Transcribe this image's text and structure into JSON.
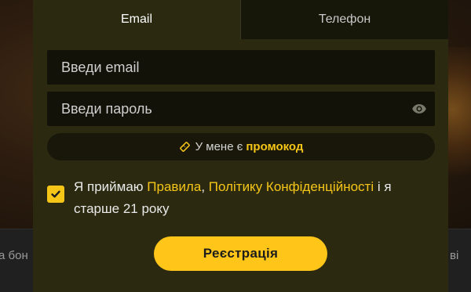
{
  "background": {
    "left_text": "а бон",
    "right_text": "ві"
  },
  "tabs": [
    {
      "label": "Email",
      "active": true
    },
    {
      "label": "Телефон",
      "active": false
    }
  ],
  "email": {
    "placeholder": "Введи email",
    "value": ""
  },
  "password": {
    "placeholder": "Введи пароль",
    "value": ""
  },
  "promo": {
    "prefix": "У мене є",
    "highlight": "промокод"
  },
  "consent": {
    "checked": true,
    "part1": "Я приймаю",
    "link_rules": "Правила",
    "sep": ",",
    "link_privacy": "Політику Конфіденційності",
    "part2": "і я старше 21 року"
  },
  "submit_label": "Реєстрація",
  "colors": {
    "accent": "#f5c518",
    "modal_bg": "#2b2a11",
    "field_bg": "#121209"
  },
  "icons": {
    "password_toggle": "eye-icon",
    "promo": "ticket-icon",
    "checkbox": "checkmark-icon"
  }
}
